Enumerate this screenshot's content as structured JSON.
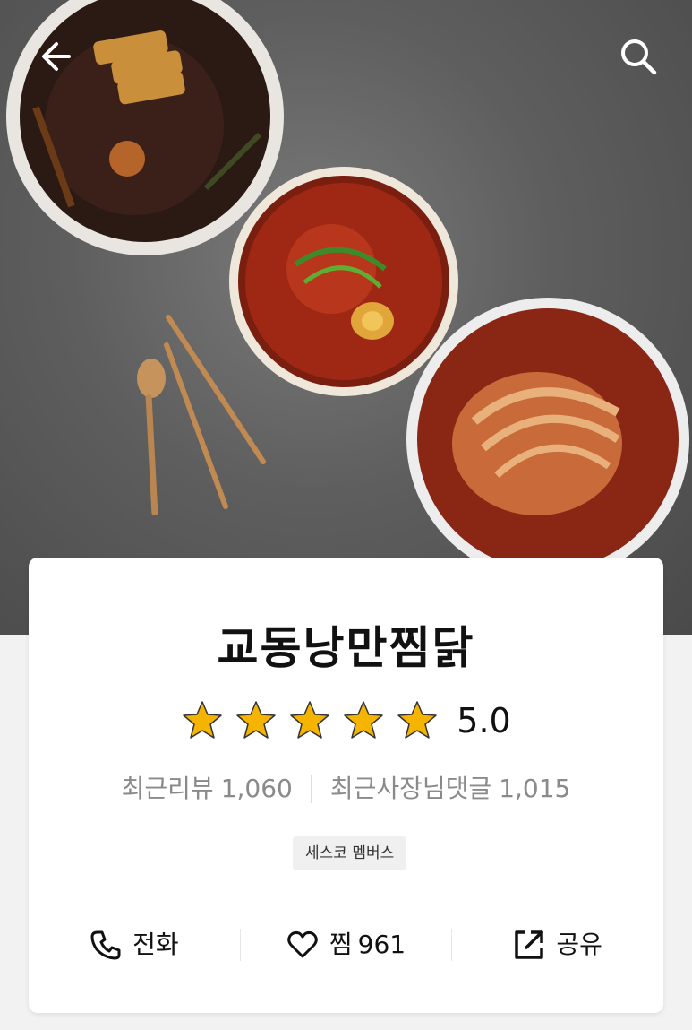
{
  "header": {
    "back_icon": "arrow-left-icon",
    "search_icon": "search-icon"
  },
  "store": {
    "name": "교동낭만찜닭",
    "rating": "5.0",
    "stars_filled": 5,
    "stars_total": 5,
    "recent_reviews_label": "최근리뷰",
    "recent_reviews_count": "1,060",
    "owner_replies_label": "최근사장님댓글",
    "owner_replies_count": "1,015",
    "badge": "세스코 멤버스"
  },
  "actions": {
    "call_label": "전화",
    "call_icon": "phone-icon",
    "favorite_label": "찜",
    "favorite_count": "961",
    "favorite_icon": "heart-icon",
    "share_label": "공유",
    "share_icon": "share-icon"
  },
  "colors": {
    "star": "#f5b400",
    "text_primary": "#111111",
    "text_secondary": "#8a8a8a"
  }
}
